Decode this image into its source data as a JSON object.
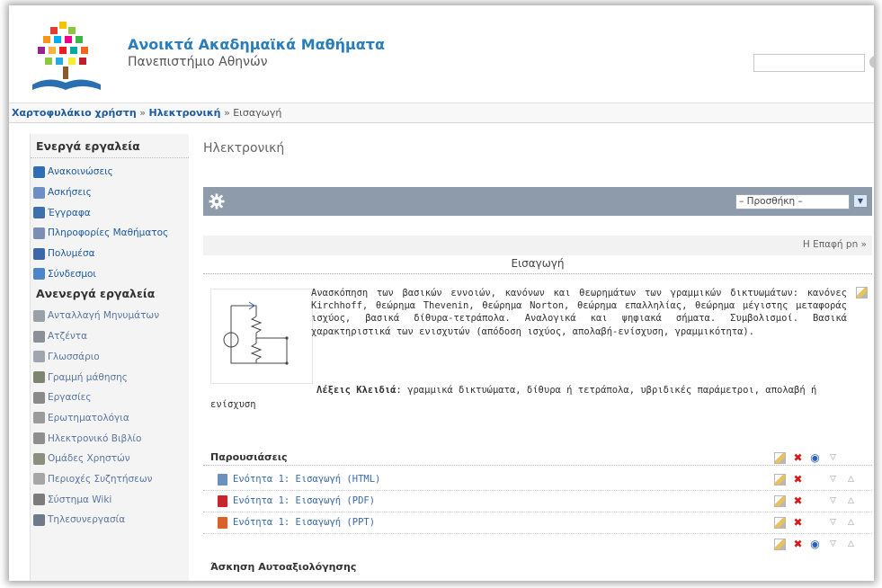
{
  "header": {
    "site_title": "Ανοικτά Ακαδημαϊκά Μαθήματα",
    "site_subtitle": "Πανεπιστήμιο Αθηνών",
    "search_placeholder": ""
  },
  "breadcrumb": {
    "portfolio": "Χαρτοφυλάκιο χρήστη",
    "course": "Ηλεκτρονική",
    "current": "Εισαγωγή",
    "separator": "»"
  },
  "sidebar": {
    "active_heading": "Ενεργά εργαλεία",
    "active_items": [
      {
        "label": "Ανακοινώσεις",
        "icon": "announcements-icon",
        "color": "#2f6db5"
      },
      {
        "label": "Ασκήσεις",
        "icon": "exercises-icon",
        "color": "#6f8fc4"
      },
      {
        "label": "Έγγραφα",
        "icon": "documents-icon",
        "color": "#3e6fae"
      },
      {
        "label": "Πληροφορίες Μαθήματος",
        "icon": "course-info-icon",
        "color": "#7a8fb5"
      },
      {
        "label": "Πολυμέσα",
        "icon": "multimedia-icon",
        "color": "#3c67a8"
      },
      {
        "label": "Σύνδεσμοι",
        "icon": "links-icon",
        "color": "#4c86c9"
      }
    ],
    "inactive_heading": "Ανενεργά εργαλεία",
    "inactive_items": [
      {
        "label": "Ανταλλαγή Μηνυμάτων",
        "icon": "messages-icon",
        "color": "#9aa0a8"
      },
      {
        "label": "Ατζέντα",
        "icon": "agenda-icon",
        "color": "#8a8f98"
      },
      {
        "label": "Γλωσσάριο",
        "icon": "glossary-icon",
        "color": "#a0a6ae"
      },
      {
        "label": "Γραμμή μάθησης",
        "icon": "learning-path-icon",
        "color": "#7d8570"
      },
      {
        "label": "Εργασίες",
        "icon": "assignments-icon",
        "color": "#8a8a8a"
      },
      {
        "label": "Ερωτηματολόγια",
        "icon": "questionnaire-icon",
        "color": "#9b9b9b"
      },
      {
        "label": "Ηλεκτρονικό Βιβλίο",
        "icon": "ebook-icon",
        "color": "#8f8f8f"
      },
      {
        "label": "Ομάδες Χρηστών",
        "icon": "user-groups-icon",
        "color": "#8a8f80"
      },
      {
        "label": "Περιοχές Συζητήσεων",
        "icon": "forums-icon",
        "color": "#a6a6a6"
      },
      {
        "label": "Σύστημα Wiki",
        "icon": "wiki-icon",
        "color": "#7c7c7c"
      },
      {
        "label": "Τηλεσυνεργασία",
        "icon": "teleconference-icon",
        "color": "#6e7a8c"
      }
    ]
  },
  "main": {
    "page_title": "Ηλεκτρονική",
    "add_select_value": "– Προσθήκη –",
    "next_link": "Η Επαφή pn »",
    "section_title": "Εισαγωγή",
    "description": "Ανασκόπηση των βασικών εννοιών, κανόνων και θεωρημάτων των γραμμικών δικτυωμάτων: κανόνες Kirchhoff, θεώρημα Thevenin, θεώρημα Norton, θεώρημα επαλληλίας, θεώρημα μέγιστης μεταφοράς ισχύος, βασικά δίθυρα-τετράπολα. Αναλογικά και ψηφιακά σήματα. Συμβολισμοί. Βασικά χαρακτηριστικά των ενισχυτών (απόδοση ισχύος, απολαβή-ενίσχυση, γραμμικότητα).",
    "keywords_label": "Λέξεις Κλειδιά",
    "keywords_text": ": γραμμικά δικτυώματα, δίθυρα ή τετράπολα, υβριδικές παράμετροι, απολαβή ή ενίσχυση",
    "resources_heading": "Παρουσιάσεις",
    "resources": [
      {
        "label": "Ενότητα 1: Εισαγωγή (HTML)",
        "icon": "html-file-icon",
        "color": "#6b8fbf"
      },
      {
        "label": "Ενότητα 1: Εισαγωγή (PDF)",
        "icon": "pdf-file-icon",
        "color": "#c9252c"
      },
      {
        "label": "Ενότητα 1: Εισαγωγή (PPT)",
        "icon": "ppt-file-icon",
        "color": "#d9622b"
      }
    ],
    "self_assessment_heading": "Άσκηση Αυτοαξιολόγησης"
  },
  "colors": {
    "brand": "#2a7dbb",
    "link": "#1d5aa0",
    "toolbar": "#8d9bab"
  }
}
